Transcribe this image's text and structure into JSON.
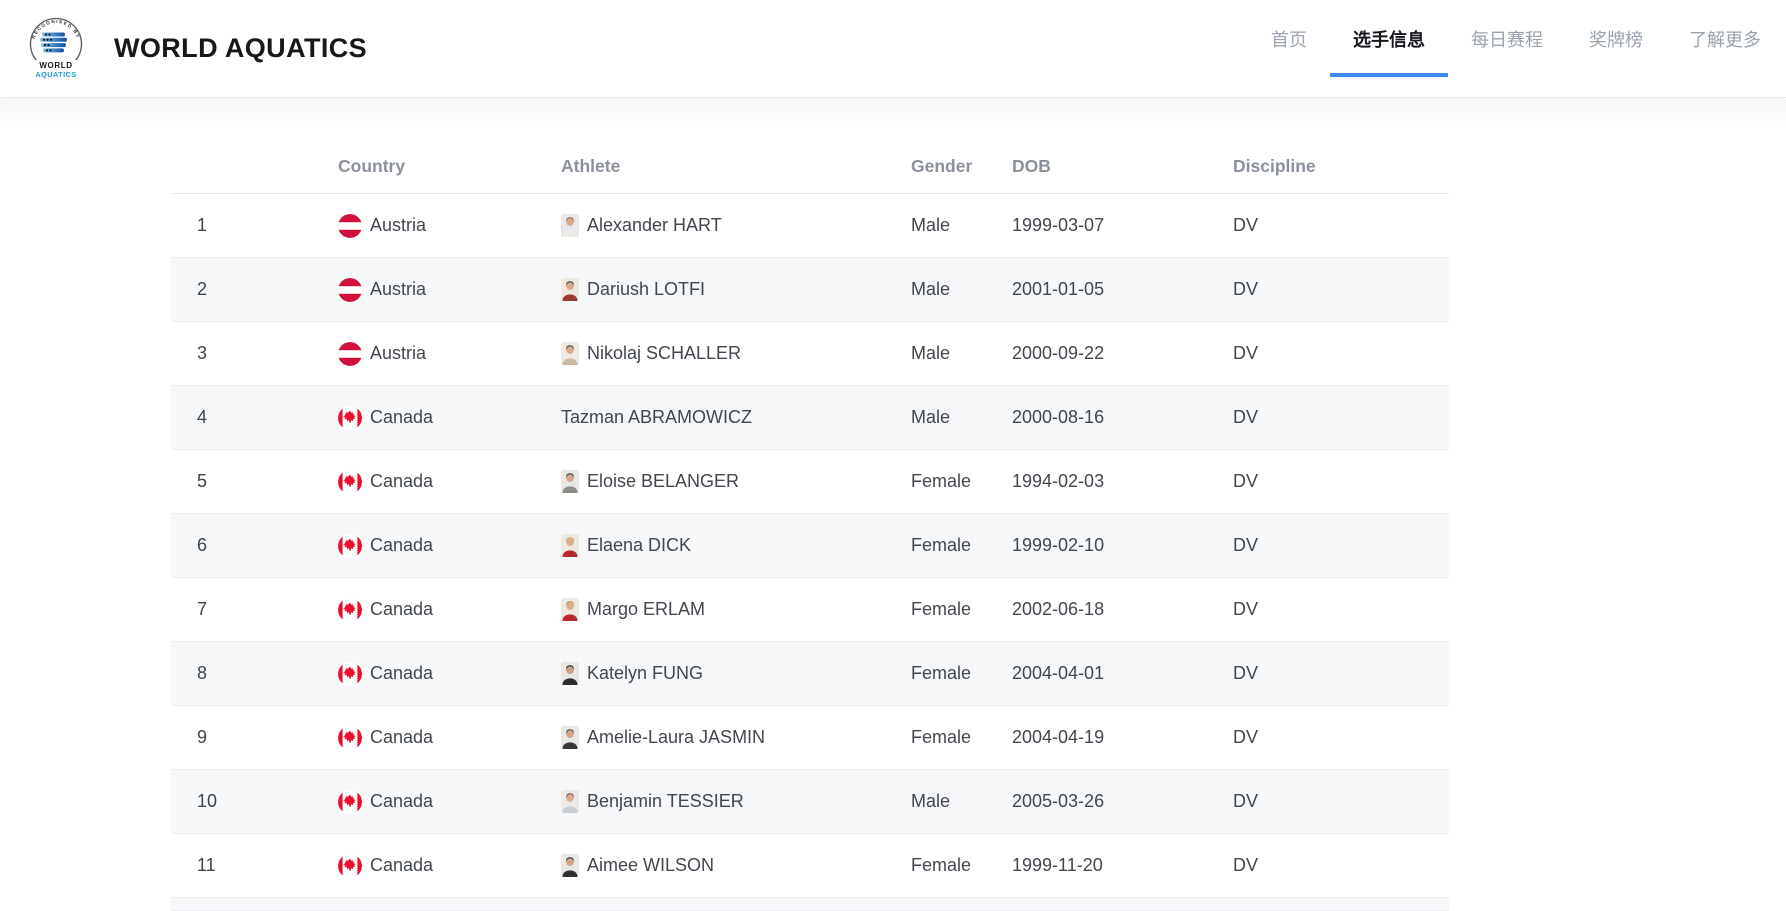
{
  "colors": {
    "accent_blue": "#3d8af7",
    "austria_red": "#d0113b",
    "canada_red": "#e8112d",
    "stripe_bg": "#f7f8fa",
    "header_label_gray": "#8b919b",
    "cell_text": "#42474e"
  },
  "header": {
    "title": "WORLD AQUATICS",
    "logo": {
      "arc_text": "RECOGNISED BY",
      "line1": "WORLD",
      "line2": "AQUATICS"
    },
    "nav": [
      {
        "label": "首页",
        "active": false
      },
      {
        "label": "选手信息",
        "active": true
      },
      {
        "label": "每日赛程",
        "active": false
      },
      {
        "label": "奖牌榜",
        "active": false
      },
      {
        "label": "了解更多",
        "active": false
      }
    ]
  },
  "table": {
    "columns": [
      "Country",
      "Athlete",
      "Gender",
      "DOB",
      "Discipline"
    ],
    "rows": [
      {
        "num": "1",
        "country": "Austria",
        "flag": "austria",
        "athlete": "Alexander HART",
        "gender": "Male",
        "dob": "1999-03-07",
        "discipline": "DV",
        "photo": {
          "bg": "#e8e8ea",
          "hair": "#8a6244",
          "skin": "#d9a98c",
          "shirt": "#efece5"
        }
      },
      {
        "num": "2",
        "country": "Austria",
        "flag": "austria",
        "athlete": "Dariush LOTFI",
        "gender": "Male",
        "dob": "2001-01-05",
        "discipline": "DV",
        "photo": {
          "bg": "#efe9e4",
          "hair": "#3f3228",
          "skin": "#d9a98c",
          "shirt": "#9e3a35"
        }
      },
      {
        "num": "3",
        "country": "Austria",
        "flag": "austria",
        "athlete": "Nikolaj SCHALLER",
        "gender": "Male",
        "dob": "2000-09-22",
        "discipline": "DV",
        "photo": {
          "bg": "#efe9e4",
          "hair": "#4a3a2c",
          "skin": "#d9ab8e",
          "shirt": "#cbb9a6"
        }
      },
      {
        "num": "4",
        "country": "Canada",
        "flag": "canada",
        "athlete": "Tazman ABRAMOWICZ",
        "gender": "Male",
        "dob": "2000-08-16",
        "discipline": "DV",
        "photo": null
      },
      {
        "num": "5",
        "country": "Canada",
        "flag": "canada",
        "athlete": "Eloise BELANGER",
        "gender": "Female",
        "dob": "1994-02-03",
        "discipline": "DV",
        "photo": {
          "bg": "#e9e7e4",
          "hair": "#3a2f28",
          "skin": "#d6a488",
          "shirt": "#8e8a86"
        }
      },
      {
        "num": "6",
        "country": "Canada",
        "flag": "canada",
        "athlete": "Elaena DICK",
        "gender": "Female",
        "dob": "1999-02-10",
        "discipline": "DV",
        "photo": {
          "bg": "#efe9e4",
          "hair": "#c9a45c",
          "skin": "#dcae90",
          "shirt": "#b5292f"
        }
      },
      {
        "num": "7",
        "country": "Canada",
        "flag": "canada",
        "athlete": "Margo ERLAM",
        "gender": "Female",
        "dob": "2002-06-18",
        "discipline": "DV",
        "photo": {
          "bg": "#efe9e4",
          "hair": "#b98f52",
          "skin": "#dcae90",
          "shirt": "#b5292f"
        }
      },
      {
        "num": "8",
        "country": "Canada",
        "flag": "canada",
        "athlete": "Katelyn FUNG",
        "gender": "Female",
        "dob": "2004-04-01",
        "discipline": "DV",
        "photo": {
          "bg": "#e9e7e4",
          "hair": "#241f1e",
          "skin": "#caa083",
          "shirt": "#2e2b2a"
        }
      },
      {
        "num": "9",
        "country": "Canada",
        "flag": "canada",
        "athlete": "Amelie-Laura JASMIN",
        "gender": "Female",
        "dob": "2004-04-19",
        "discipline": "DV",
        "photo": {
          "bg": "#e9e7e4",
          "hair": "#55402f",
          "skin": "#d3a486",
          "shirt": "#3b3837"
        }
      },
      {
        "num": "10",
        "country": "Canada",
        "flag": "canada",
        "athlete": "Benjamin TESSIER",
        "gender": "Male",
        "dob": "2005-03-26",
        "discipline": "DV",
        "photo": {
          "bg": "#eceae8",
          "hair": "#6d4f35",
          "skin": "#dcae90",
          "shirt": "#c9cdd1"
        }
      },
      {
        "num": "11",
        "country": "Canada",
        "flag": "canada",
        "athlete": "Aimee WILSON",
        "gender": "Female",
        "dob": "1999-11-20",
        "discipline": "DV",
        "photo": {
          "bg": "#e9e7e4",
          "hair": "#2e2620",
          "skin": "#d3a486",
          "shirt": "#322f2d"
        }
      }
    ]
  }
}
